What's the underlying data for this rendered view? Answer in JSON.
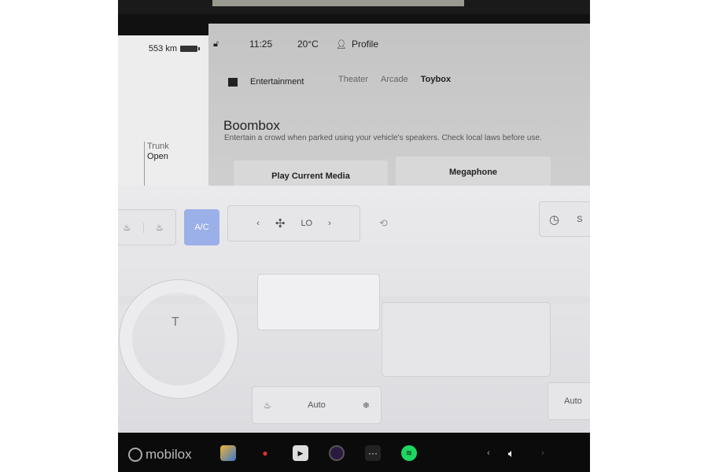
{
  "status": {
    "range": "553 km",
    "time": "11:25",
    "temperature": "20°C",
    "profile": "Profile"
  },
  "trunk": {
    "label": "Trunk",
    "state": "Open"
  },
  "entertainment": {
    "title": "Entertainment",
    "tabs": [
      {
        "label": "Theater",
        "active": false
      },
      {
        "label": "Arcade",
        "active": false
      },
      {
        "label": "Toybox",
        "active": true
      }
    ]
  },
  "boombox": {
    "title": "Boombox",
    "description": "Entertain a crowd when parked using your vehicle's speakers. Check local laws before use.",
    "buttons": [
      "Play Current Media",
      "Megaphone"
    ]
  },
  "climate": {
    "ac_label": "A/C",
    "fan_level": "LO",
    "seat_auto_left": "Auto",
    "seat_auto_right": "Auto",
    "right_partial": "S",
    "ac_color": "#9bb0e8"
  },
  "dock": {
    "watermark": "mobilox",
    "icons": [
      "toybox-icon",
      "arcade-joystick-icon",
      "theater-icon",
      "camera-icon",
      "more-icon",
      "spotify-icon",
      "volume-icon"
    ]
  }
}
